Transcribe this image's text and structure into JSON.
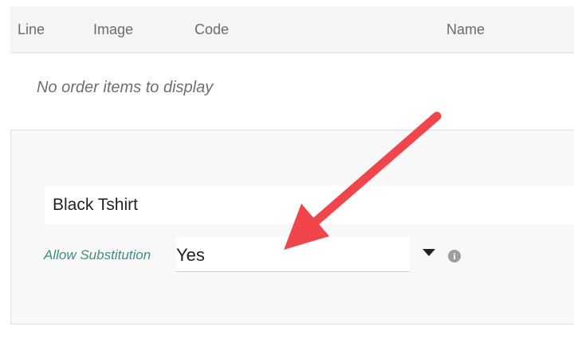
{
  "table": {
    "columns": [
      "Line",
      "Image",
      "Code",
      "Name"
    ],
    "empty_message": "No order items to display"
  },
  "item": {
    "product_name": "Black Tshirt",
    "substitution_label": "Allow Substitution",
    "substitution_value": "Yes"
  },
  "icons": {
    "dropdown": "caret-down-icon",
    "info": "info-icon",
    "annotation": "red-arrow-icon"
  },
  "colors": {
    "label_accent": "#3a8f8a",
    "annotation_arrow": "#f0454a"
  }
}
